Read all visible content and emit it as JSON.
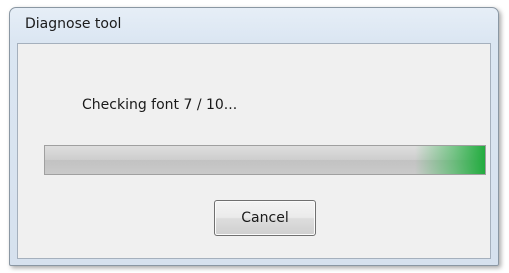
{
  "window": {
    "title": "Diagnose tool"
  },
  "dialog": {
    "message": "Checking font 7 / 10...",
    "progress": {
      "value": 1.0,
      "fill_color": "#cdcdcd",
      "glow_color": "#19aa37"
    },
    "cancel_label": "Cancel"
  }
}
